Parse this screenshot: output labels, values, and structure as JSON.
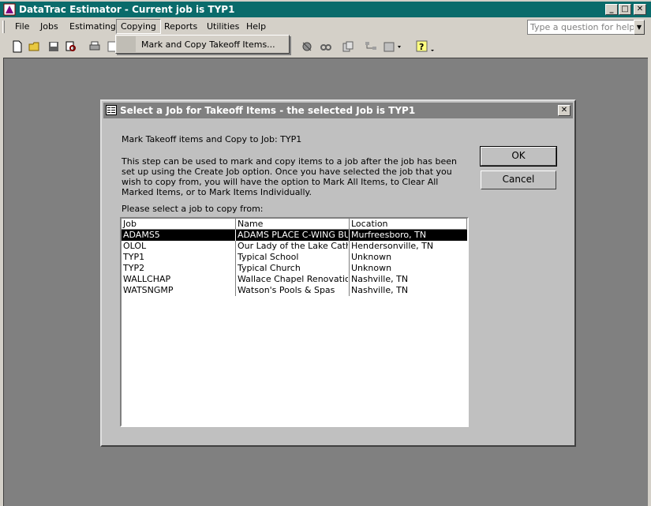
{
  "window": {
    "title": "DataTrac Estimator - Current job is TYP1",
    "minimize": "_",
    "maximize": "□",
    "close": "✕"
  },
  "menubar": {
    "items": [
      "File",
      "Jobs",
      "Estimating",
      "Copying",
      "Reports",
      "Utilities",
      "Help"
    ],
    "open_menu": "Copying",
    "ask_placeholder": "Type a question for help"
  },
  "dropdown": {
    "items": [
      "Mark and Copy Takeoff Items..."
    ]
  },
  "toolbar": {
    "icons": [
      "new-icon",
      "open-icon",
      "save-icon",
      "print-preview-icon",
      "print-icon",
      "page-setup-icon",
      "estimate-icon",
      "link-icon",
      "copy-icon",
      "tree-icon",
      "report-icon",
      "help-icon"
    ]
  },
  "dialog": {
    "title": "Select a Job for Takeoff Items - the selected Job is TYP1",
    "close": "✕",
    "heading": "Mark Takeoff items and Copy to Job: TYP1",
    "description": "This step can be used to mark and copy items to a job after the job has been set up using the Create Job option.  Once you have selected the job that you wish to copy from, you will have the option to Mark All Items, to Clear All Marked Items, or to Mark Items Individually.",
    "list_prompt": "Please select a job to copy from:",
    "ok_label": "OK",
    "cancel_label": "Cancel",
    "columns": [
      "Job",
      "Name",
      "Location"
    ],
    "rows": [
      {
        "job": "ADAMS5",
        "name": "ADAMS PLACE C-WING BUILDING",
        "location": "Murfreesboro, TN",
        "selected": true
      },
      {
        "job": "OLOL",
        "name": "Our Lady of the Lake Catholic",
        "location": "Hendersonville, TN",
        "selected": false
      },
      {
        "job": "TYP1",
        "name": "Typical School",
        "location": "Unknown",
        "selected": false
      },
      {
        "job": "TYP2",
        "name": "Typical Church",
        "location": "Unknown",
        "selected": false
      },
      {
        "job": "WALLCHAP",
        "name": "Wallace Chapel Renovations",
        "location": "Nashville, TN",
        "selected": false
      },
      {
        "job": "WATSNGMP",
        "name": "Watson's Pools & Spas",
        "location": "Nashville, TN",
        "selected": false
      }
    ]
  },
  "colors": {
    "titlebar": "#0a6b6b",
    "workspace": "#808080",
    "dialog_bg": "#c0c0c0",
    "selection": "#000000"
  }
}
